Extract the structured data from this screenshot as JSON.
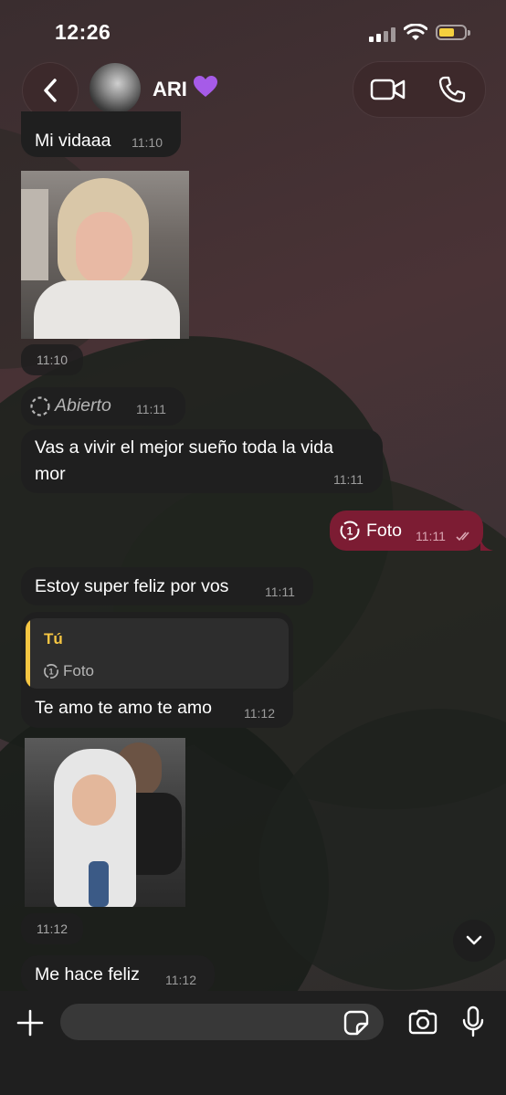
{
  "status_bar": {
    "time": "12:26"
  },
  "header": {
    "contact_name": "ARI",
    "name_emoji": "💜"
  },
  "messages": [
    {
      "text": "Mi vidaaa",
      "time": "11:10"
    },
    {
      "photo_time": "11:10"
    },
    {
      "text": "Abierto",
      "time": "11:11"
    },
    {
      "text_line1": "Vas a vivir el mejor sueño toda la vida",
      "text_line2": "mor",
      "time": "11:11"
    },
    {
      "text": "Foto",
      "time": "11:11"
    },
    {
      "text": "Estoy super feliz por vos",
      "time": "11:11"
    },
    {
      "reply_author": "Tú",
      "reply_text": "Foto",
      "text": "Te amo te amo te amo",
      "time": "11:12"
    },
    {
      "photo_time": "11:12"
    },
    {
      "text": "Me hace feliz",
      "time": "11:12"
    }
  ],
  "view_once_badge": "1",
  "colors": {
    "outgoing_bubble": "#7c1c33",
    "incoming_bubble": "#1f1f1f",
    "reply_accent": "#f5c542",
    "reply_author": "#f5c542"
  }
}
